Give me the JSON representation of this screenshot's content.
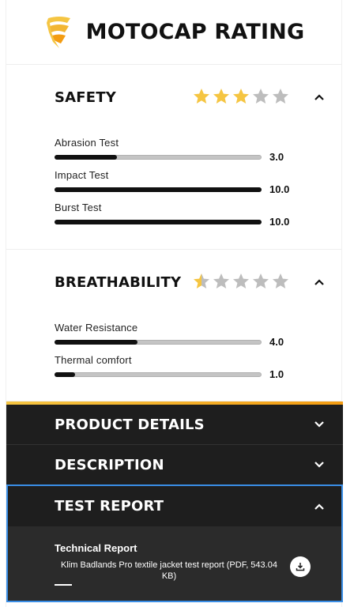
{
  "header": {
    "title": "MOTOCAP RATING",
    "logo_icon": "shield-stripes-icon",
    "logo_colors": [
      "#f5c542",
      "#f39c12"
    ]
  },
  "safety": {
    "title": "SAFETY",
    "stars": {
      "rating": 3,
      "max": 5
    },
    "metrics": [
      {
        "label": "Abrasion Test",
        "value": "3.0",
        "fraction": 0.3
      },
      {
        "label": "Impact Test",
        "value": "10.0",
        "fraction": 1.0
      },
      {
        "label": "Burst Test",
        "value": "10.0",
        "fraction": 1.0
      }
    ]
  },
  "breathability": {
    "title": "BREATHABILITY",
    "stars": {
      "rating": 0.5,
      "max": 5
    },
    "metrics": [
      {
        "label": "Water Resistance",
        "value": "4.0",
        "fraction": 0.4
      },
      {
        "label": "Thermal comfort",
        "value": "1.0",
        "fraction": 0.1
      }
    ]
  },
  "accordions": {
    "product_details": "PRODUCT DETAILS",
    "description": "DESCRIPTION",
    "test_report": "TEST REPORT"
  },
  "test_report": {
    "label": "Technical Report",
    "file": "Klim Badlands Pro textile jacket test report (PDF, 543.04 KB)"
  },
  "colors": {
    "star_filled": "#f5c542",
    "star_empty": "#bdbdbd",
    "accent": "#f39c12",
    "dark_bg": "#1e1e1e",
    "focus": "#3a8ee6"
  }
}
